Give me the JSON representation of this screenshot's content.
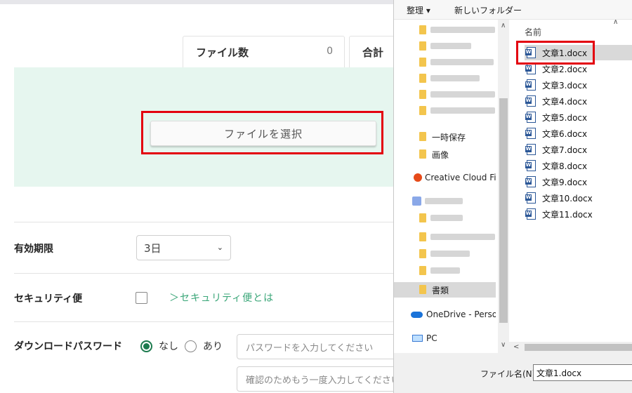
{
  "page": {
    "stats": {
      "files_label": "ファイル数",
      "files_count": "0",
      "total_label": "合計"
    },
    "select_button": "ファイルを選択",
    "expiry": {
      "label": "有効期限",
      "selected": "3日"
    },
    "security": {
      "label": "セキュリティ便",
      "link": "＞セキュリティ便とは"
    },
    "download_password": {
      "label": "ダウンロードパスワード",
      "option_none": "なし",
      "option_yes": "あり",
      "password_placeholder": "パスワードを入力してください",
      "confirm_placeholder": "確認のためもう一度入力してください"
    }
  },
  "dialog": {
    "toolbar": {
      "organize": "整理 ▾",
      "new_folder": "新しいフォルダー"
    },
    "nav": {
      "temp_folder": "一時保存",
      "images_folder": "画像",
      "creative_cloud": "Creative Cloud Files",
      "documents_folder": "書類",
      "onedrive": "OneDrive - Personal",
      "pc": "PC"
    },
    "column_header": "名前",
    "files": [
      "文章1.docx",
      "文章2.docx",
      "文章3.docx",
      "文章4.docx",
      "文章5.docx",
      "文章6.docx",
      "文章7.docx",
      "文章8.docx",
      "文章9.docx",
      "文章10.docx",
      "文章11.docx"
    ],
    "filename_label": "ファイル名(N):",
    "filename_value": "文章1.docx"
  },
  "colors": {
    "highlight": "#e3000f",
    "accent_green": "#3aa678",
    "dropzone_bg": "#e6f6ef",
    "radio_green": "#1d7b4f"
  }
}
